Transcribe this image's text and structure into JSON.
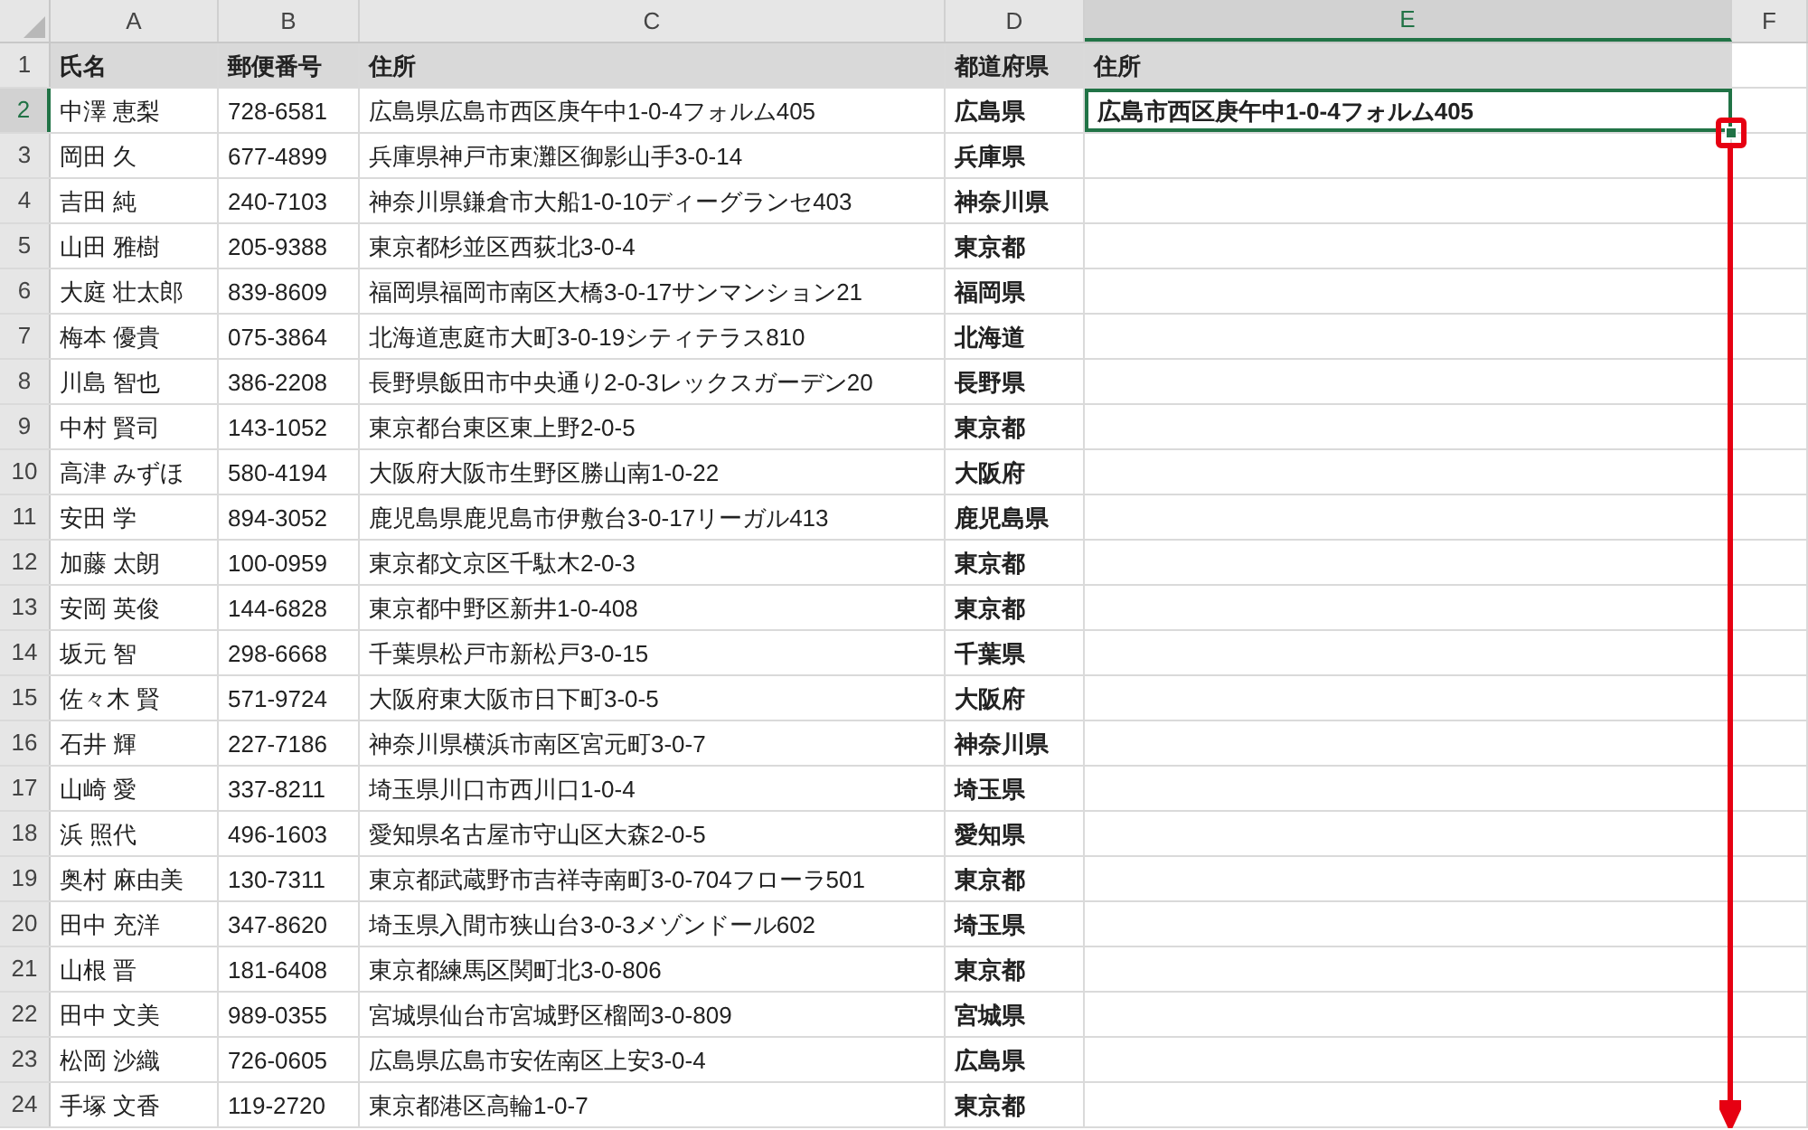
{
  "columns": [
    {
      "label": "A",
      "selected": false
    },
    {
      "label": "B",
      "selected": false
    },
    {
      "label": "C",
      "selected": false
    },
    {
      "label": "D",
      "selected": false
    },
    {
      "label": "E",
      "selected": true
    },
    {
      "label": "F",
      "selected": false
    }
  ],
  "rows": [
    {
      "number": "1",
      "selected": false,
      "header": true,
      "cells": [
        "氏名",
        "郵便番号",
        "住所",
        "都道府県",
        "住所"
      ]
    },
    {
      "number": "2",
      "selected": true,
      "header": false,
      "cells": [
        "中澤 恵梨",
        "728-6581",
        "広島県広島市西区庚午中1-0-4フォルム405",
        "広島県",
        "広島市西区庚午中1-0-4フォルム405"
      ]
    },
    {
      "number": "3",
      "selected": false,
      "header": false,
      "cells": [
        "岡田 久",
        "677-4899",
        "兵庫県神戸市東灘区御影山手3-0-14",
        "兵庫県"
      ]
    },
    {
      "number": "4",
      "selected": false,
      "header": false,
      "cells": [
        "吉田 純",
        "240-7103",
        "神奈川県鎌倉市大船1-0-10ディーグランセ403",
        "神奈川県"
      ]
    },
    {
      "number": "5",
      "selected": false,
      "header": false,
      "cells": [
        "山田 雅樹",
        "205-9388",
        "東京都杉並区西荻北3-0-4",
        "東京都"
      ]
    },
    {
      "number": "6",
      "selected": false,
      "header": false,
      "cells": [
        "大庭 壮太郎",
        "839-8609",
        "福岡県福岡市南区大橋3-0-17サンマンション21",
        "福岡県"
      ]
    },
    {
      "number": "7",
      "selected": false,
      "header": false,
      "cells": [
        "梅本 優貴",
        "075-3864",
        "北海道恵庭市大町3-0-19シティテラス810",
        "北海道"
      ]
    },
    {
      "number": "8",
      "selected": false,
      "header": false,
      "cells": [
        "川島 智也",
        "386-2208",
        "長野県飯田市中央通り2-0-3レックスガーデン20",
        "長野県"
      ]
    },
    {
      "number": "9",
      "selected": false,
      "header": false,
      "cells": [
        "中村 賢司",
        "143-1052",
        "東京都台東区東上野2-0-5",
        "東京都"
      ]
    },
    {
      "number": "10",
      "selected": false,
      "header": false,
      "cells": [
        "高津 みずほ",
        "580-4194",
        "大阪府大阪市生野区勝山南1-0-22",
        "大阪府"
      ]
    },
    {
      "number": "11",
      "selected": false,
      "header": false,
      "cells": [
        "安田 学",
        "894-3052",
        "鹿児島県鹿児島市伊敷台3-0-17リーガル413",
        "鹿児島県"
      ]
    },
    {
      "number": "12",
      "selected": false,
      "header": false,
      "cells": [
        "加藤 太朗",
        "100-0959",
        "東京都文京区千駄木2-0-3",
        "東京都"
      ]
    },
    {
      "number": "13",
      "selected": false,
      "header": false,
      "cells": [
        "安岡 英俊",
        "144-6828",
        "東京都中野区新井1-0-408",
        "東京都"
      ]
    },
    {
      "number": "14",
      "selected": false,
      "header": false,
      "cells": [
        "坂元 智",
        "298-6668",
        "千葉県松戸市新松戸3-0-15",
        "千葉県"
      ]
    },
    {
      "number": "15",
      "selected": false,
      "header": false,
      "cells": [
        "佐々木 賢",
        "571-9724",
        "大阪府東大阪市日下町3-0-5",
        "大阪府"
      ]
    },
    {
      "number": "16",
      "selected": false,
      "header": false,
      "cells": [
        "石井 輝",
        "227-7186",
        "神奈川県横浜市南区宮元町3-0-7",
        "神奈川県"
      ]
    },
    {
      "number": "17",
      "selected": false,
      "header": false,
      "cells": [
        "山崎 愛",
        "337-8211",
        "埼玉県川口市西川口1-0-4",
        "埼玉県"
      ]
    },
    {
      "number": "18",
      "selected": false,
      "header": false,
      "cells": [
        "浜 照代",
        "496-1603",
        "愛知県名古屋市守山区大森2-0-5",
        "愛知県"
      ]
    },
    {
      "number": "19",
      "selected": false,
      "header": false,
      "cells": [
        "奥村 麻由美",
        "130-7311",
        "東京都武蔵野市吉祥寺南町3-0-704フローラ501",
        "東京都"
      ]
    },
    {
      "number": "20",
      "selected": false,
      "header": false,
      "cells": [
        "田中 充洋",
        "347-8620",
        "埼玉県入間市狭山台3-0-3メゾンドール602",
        "埼玉県"
      ]
    },
    {
      "number": "21",
      "selected": false,
      "header": false,
      "cells": [
        "山根 晋",
        "181-6408",
        "東京都練馬区関町北3-0-806",
        "東京都"
      ]
    },
    {
      "number": "22",
      "selected": false,
      "header": false,
      "cells": [
        "田中 文美",
        "989-0355",
        "宮城県仙台市宮城野区榴岡3-0-809",
        "宮城県"
      ]
    },
    {
      "number": "23",
      "selected": false,
      "header": false,
      "cells": [
        "松岡 沙織",
        "726-0605",
        "広島県広島市安佐南区上安3-0-4",
        "広島県"
      ]
    },
    {
      "number": "24",
      "selected": false,
      "header": false,
      "cells": [
        "手塚 文香",
        "119-2720",
        "東京都港区高輪1-0-7",
        "東京都"
      ]
    }
  ]
}
